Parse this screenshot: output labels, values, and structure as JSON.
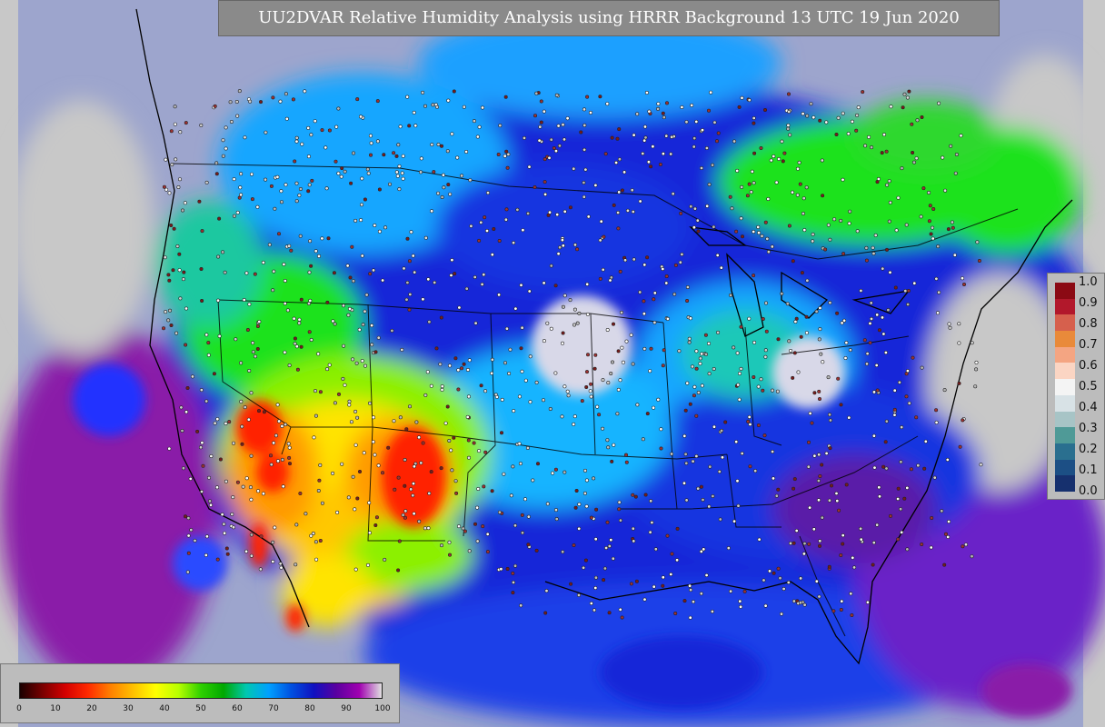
{
  "title": "UU2DVAR Relative Humidity Analysis using HRRR Background 13 UTC 19 Jun 2020",
  "legend_right": {
    "ticks": [
      "1.0",
      "0.9",
      "0.8",
      "0.7",
      "0.6",
      "0.5",
      "0.4",
      "0.3",
      "0.2",
      "0.1",
      "0.0"
    ],
    "colors": [
      "#8b0a14",
      "#b2182b",
      "#d6604d",
      "#e98a3a",
      "#f4a582",
      "#fbd5c3",
      "#f4f4f4",
      "#d8e2e6",
      "#a7c4c6",
      "#4f9a97",
      "#2a6f8f",
      "#1c4f85",
      "#16306e"
    ]
  },
  "legend_bottom": {
    "ticks": [
      "0",
      "10",
      "20",
      "30",
      "40",
      "50",
      "60",
      "70",
      "80",
      "90",
      "100"
    ],
    "colors": [
      "#1a0000",
      "#7a0000",
      "#d40000",
      "#ff2a00",
      "#ff8000",
      "#ffc000",
      "#ffff00",
      "#b8ff00",
      "#2fd000",
      "#00a800",
      "#00c8b0",
      "#00a0ff",
      "#0050e0",
      "#1010c0",
      "#5a00a0",
      "#a000b0",
      "#e0e0e0"
    ]
  },
  "map_colors": {
    "ocean_bg": "#c8c8c8",
    "blue": "#1428d8",
    "cyan": "#16a6ff",
    "teal": "#1fc9c0",
    "green": "#1ee21e",
    "lightgreen": "#8cf000",
    "yellow": "#ffe400",
    "orange": "#ff9a00",
    "red": "#ff2200",
    "purple": "#8a1aa8",
    "lavender": "#c8a0e0"
  }
}
